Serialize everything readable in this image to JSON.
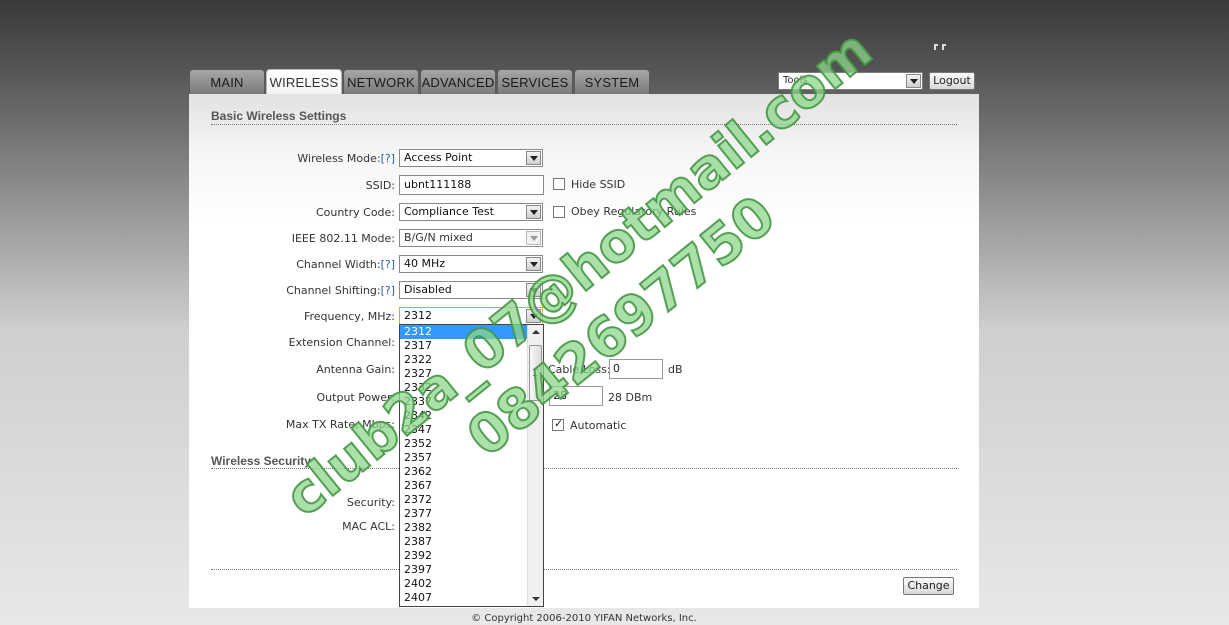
{
  "tabs": [
    "MAIN",
    "WIRELESS",
    "NETWORK",
    "ADVANCED",
    "SERVICES",
    "SYSTEM"
  ],
  "active_tab": "WIRELESS",
  "toolbar": {
    "tools_value": "Tools",
    "logout_label": "Logout"
  },
  "basic": {
    "title": "Basic Wireless Settings",
    "wireless_mode": {
      "label": "Wireless Mode:",
      "help": "[?]",
      "value": "Access Point"
    },
    "ssid": {
      "label": "SSID:",
      "value": "ubnt111188",
      "hide_label": "Hide SSID"
    },
    "country_code": {
      "label": "Country Code:",
      "value": "Compliance Test",
      "obey_label": "Obey Regulatory Rules"
    },
    "ieee_mode": {
      "label": "IEEE 802.11 Mode:",
      "value": "B/G/N mixed"
    },
    "channel_width": {
      "label": "Channel Width:",
      "help": "[?]",
      "value": "40 MHz"
    },
    "channel_shifting": {
      "label": "Channel Shifting:",
      "help": "[?]",
      "value": "Disabled"
    },
    "frequency": {
      "label": "Frequency, MHz:",
      "value": "2312"
    },
    "extension_channel": {
      "label": "Extension Channel:"
    },
    "antenna_gain": {
      "label": "Antenna Gain:",
      "cable_loss_label": "Cable Loss:",
      "cable_loss_value": "0",
      "cable_loss_unit": "dB"
    },
    "output_power": {
      "label": "Output Power:",
      "value": "28",
      "unit": "28 DBm"
    },
    "max_tx_rate": {
      "label": "Max TX Rate, Mbps:",
      "automatic_label": "Automatic"
    }
  },
  "security": {
    "title": "Wireless Security",
    "security_label": "Security:",
    "mac_acl_label": "MAC ACL:"
  },
  "change_label": "Change",
  "frequency_options": [
    "2312",
    "2317",
    "2322",
    "2327",
    "2332",
    "2337",
    "2342",
    "2347",
    "2352",
    "2357",
    "2362",
    "2367",
    "2372",
    "2377",
    "2382",
    "2387",
    "2392",
    "2397",
    "2402",
    "2407"
  ],
  "footer": "© Copyright 2006-2010 YIFAN Networks, Inc.",
  "watermark": {
    "line1": "club2a_07@hotmail.com",
    "line2": "0842697750",
    "color": "#8cd78c"
  }
}
